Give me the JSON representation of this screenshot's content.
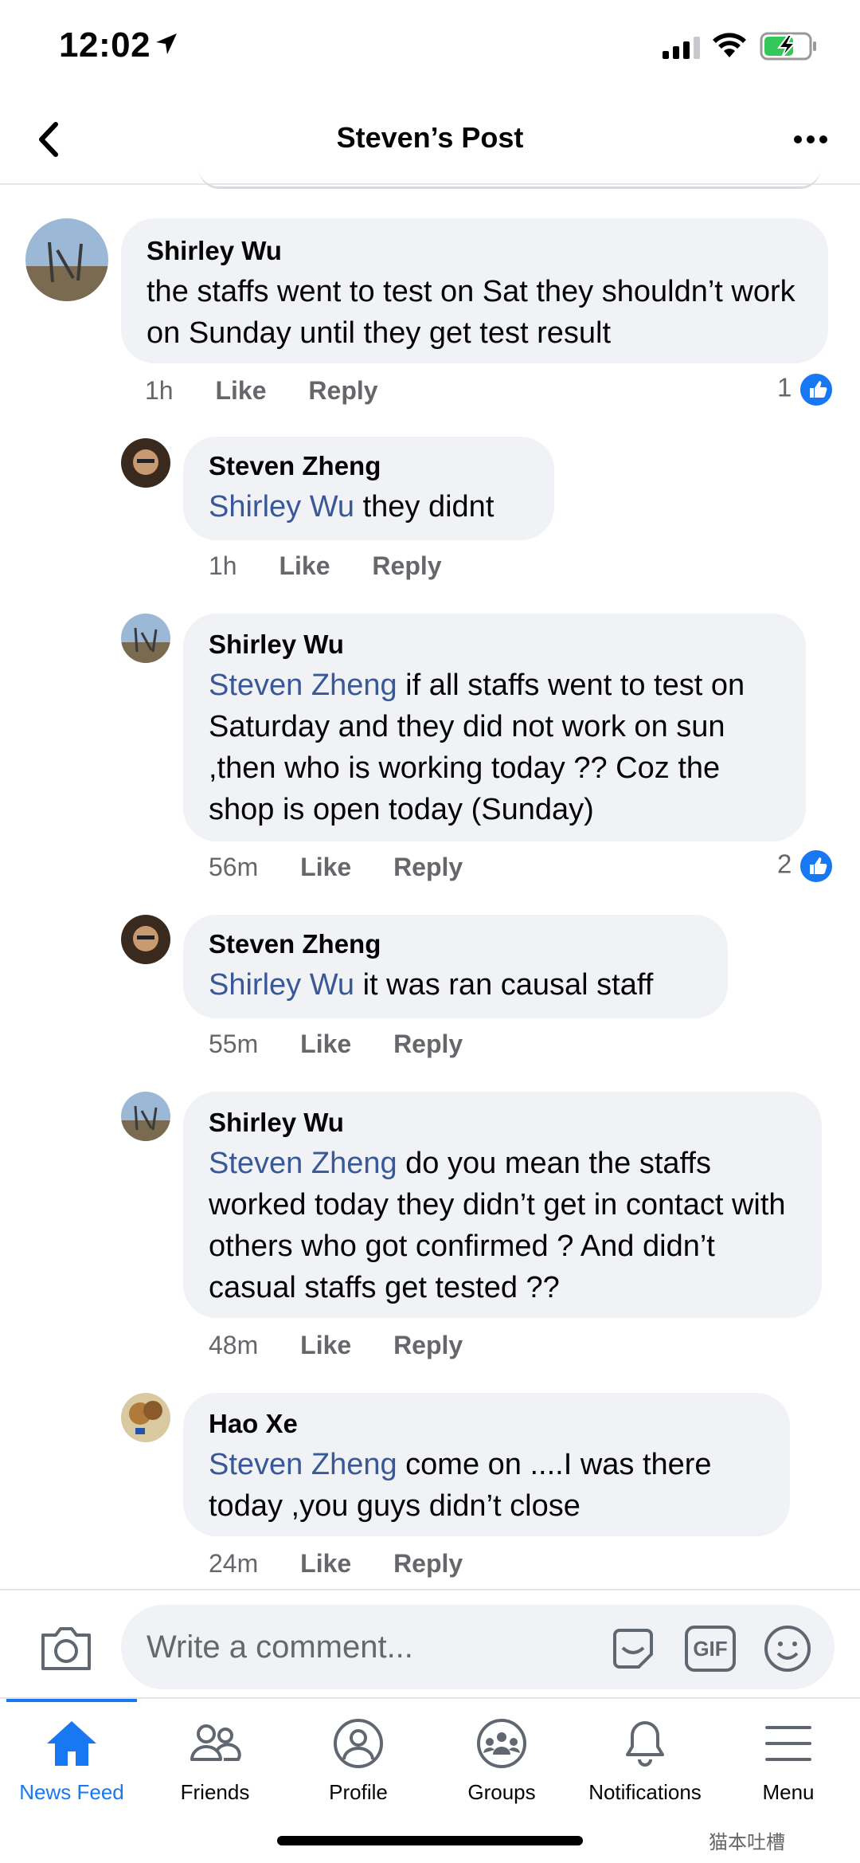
{
  "status": {
    "time": "12:02"
  },
  "header": {
    "title": "Steven’s Post"
  },
  "comments": [
    {
      "author": "Shirley Wu",
      "mention": "",
      "text": "the staffs went to test on Sat they shouldn’t work on Sunday until they get test result",
      "time": "1h",
      "like": "Like",
      "reply": "Reply",
      "likes": "1"
    },
    {
      "author": "Steven Zheng",
      "mention": "Shirley Wu",
      "text": "they didnt",
      "time": "1h",
      "like": "Like",
      "reply": "Reply",
      "likes": ""
    },
    {
      "author": "Shirley Wu",
      "mention": "Steven Zheng",
      "text": "if all staffs went to test on Saturday and they did not work on sun ,then who is working today ?? Coz the shop is open today (Sunday)",
      "time": "56m",
      "like": "Like",
      "reply": "Reply",
      "likes": "2"
    },
    {
      "author": "Steven Zheng",
      "mention": "Shirley Wu",
      "text": "it was ran causal staff",
      "time": "55m",
      "like": "Like",
      "reply": "Reply",
      "likes": ""
    },
    {
      "author": "Shirley Wu",
      "mention": "Steven Zheng",
      "text": "do you mean the staffs worked today they didn’t get in contact with others who got confirmed ? And didn’t casual staffs get tested ??",
      "time": "48m",
      "like": "Like",
      "reply": "Reply",
      "likes": ""
    },
    {
      "author": "Hao Xe",
      "mention": "Steven Zheng",
      "text": "come on ....I was there today ,you guys didn’t close",
      "time": "24m",
      "like": "Like",
      "reply": "Reply",
      "likes": ""
    }
  ],
  "composer": {
    "placeholder": "Write a comment...",
    "gif_label": "GIF"
  },
  "tabs": [
    {
      "label": "News Feed",
      "icon": "home-icon"
    },
    {
      "label": "Friends",
      "icon": "friends-icon"
    },
    {
      "label": "Profile",
      "icon": "profile-icon"
    },
    {
      "label": "Groups",
      "icon": "groups-icon"
    },
    {
      "label": "Notifications",
      "icon": "bell-icon"
    },
    {
      "label": "Menu",
      "icon": "menu-icon"
    }
  ],
  "watermark": "猫本吐槽",
  "colors": {
    "accent": "#1877f2",
    "mention": "#385898",
    "bubble": "#f0f2f5",
    "battery": "#34c759"
  }
}
